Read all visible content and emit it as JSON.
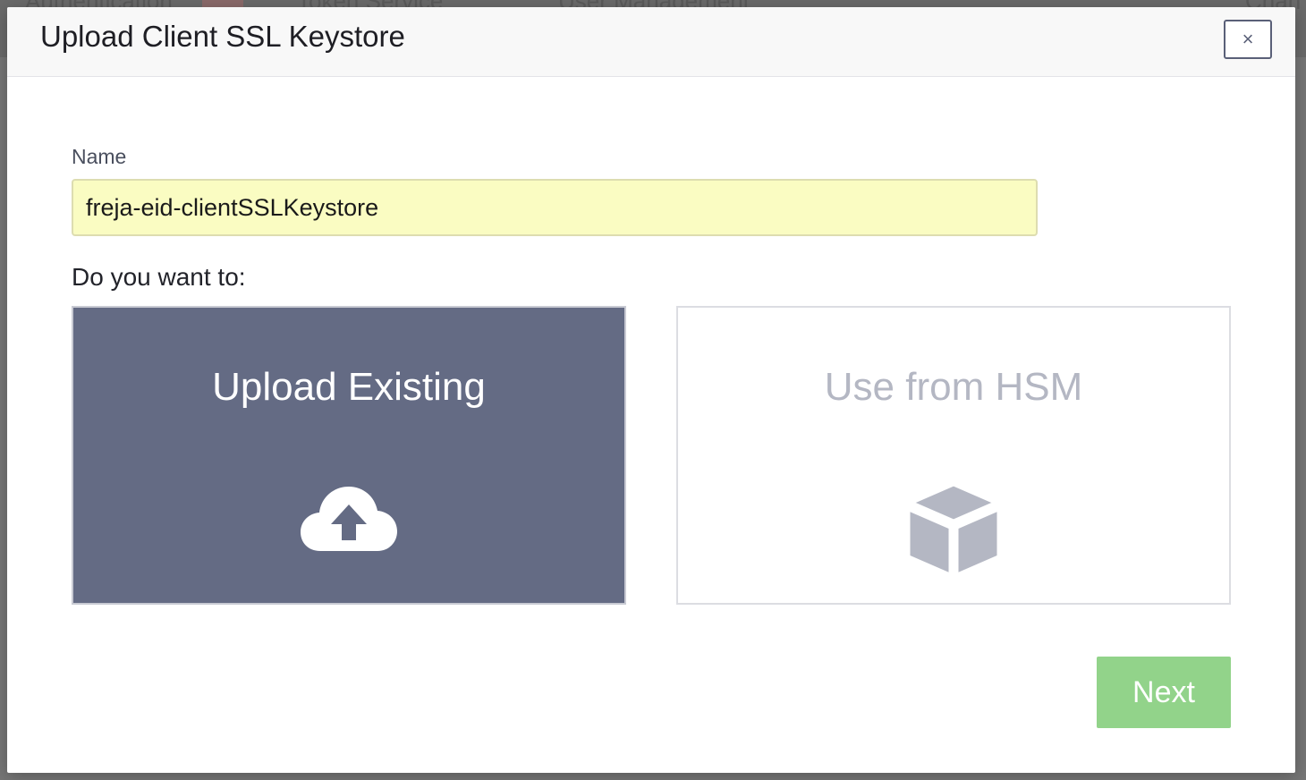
{
  "background": {
    "tabs": [
      "Authentication",
      "Token Service",
      "User Management",
      "Chan"
    ]
  },
  "modal": {
    "title": "Upload Client SSL Keystore",
    "close_label": "×",
    "name_label": "Name",
    "name_value": "freja-eid-clientSSLKeystore",
    "question": "Do you want to:",
    "options": [
      {
        "label": "Upload Existing",
        "icon": "cloud-upload-icon",
        "selected": true
      },
      {
        "label": "Use from HSM",
        "icon": "cube-icon",
        "selected": false
      }
    ],
    "next_label": "Next"
  },
  "colors": {
    "selected_card": "#646b84",
    "unselected_text": "#b4b7c3",
    "next_button": "#92d38a",
    "input_background": "#fafcc2"
  }
}
